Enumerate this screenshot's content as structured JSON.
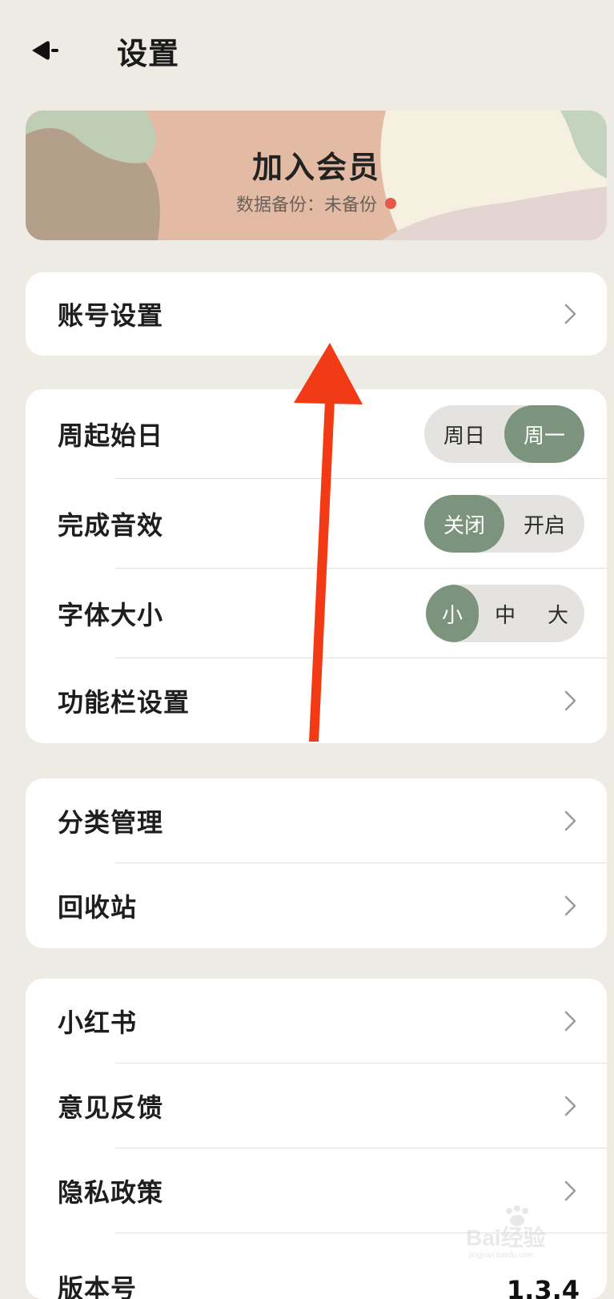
{
  "header": {
    "title": "设置"
  },
  "banner": {
    "title": "加入会员",
    "subtitle": "数据备份：未备份",
    "status_color": "#E45A4A"
  },
  "card_account": {
    "items": [
      {
        "label": "账号设置"
      }
    ]
  },
  "card_prefs": {
    "week_start": {
      "label": "周起始日",
      "options": [
        "周日",
        "周一"
      ],
      "selected": "周一"
    },
    "sound": {
      "label": "完成音效",
      "options": [
        "关闭",
        "开启"
      ],
      "selected": "关闭"
    },
    "font_size": {
      "label": "字体大小",
      "options": [
        "小",
        "中",
        "大"
      ],
      "selected": "小"
    },
    "toolbar": {
      "label": "功能栏设置"
    }
  },
  "card_manage": {
    "items": [
      {
        "label": "分类管理"
      },
      {
        "label": "回收站"
      }
    ]
  },
  "card_about": {
    "items": [
      {
        "label": "小红书"
      },
      {
        "label": "意见反馈"
      },
      {
        "label": "隐私政策"
      }
    ],
    "version": {
      "label": "版本号",
      "value": "1.3.4"
    }
  },
  "watermark": {
    "text": "Bai经验",
    "sub": "jingyan.baidu.com"
  },
  "colors": {
    "background": "#EEEBE4",
    "accent": "#7C947D",
    "annotation_arrow": "#F23A17"
  },
  "icons": {
    "back": "back-arrow-icon",
    "chevron": "chevron-right-icon"
  }
}
